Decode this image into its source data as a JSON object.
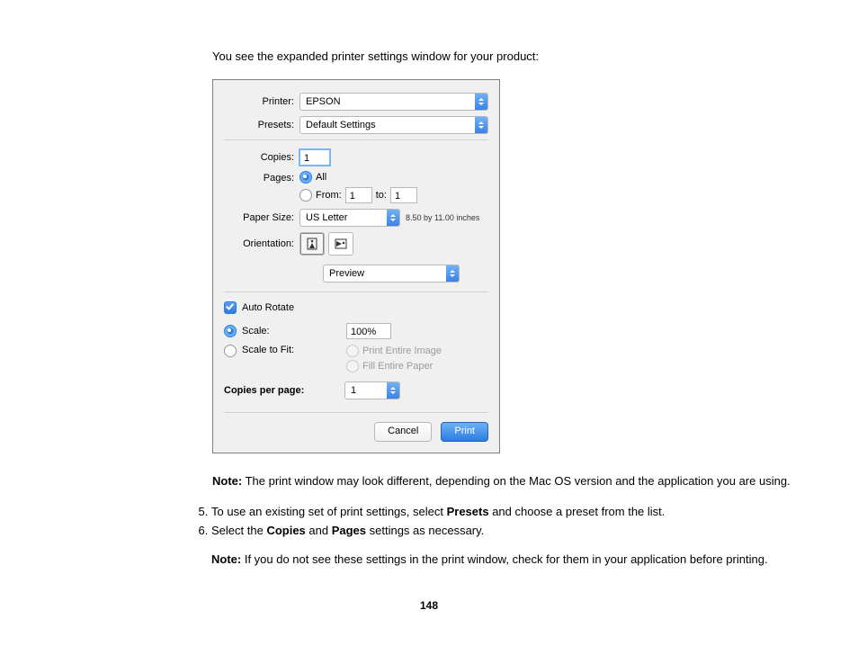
{
  "intro": "You see the expanded printer settings window for your product:",
  "dialog": {
    "labels": {
      "printer": "Printer:",
      "presets": "Presets:",
      "copies": "Copies:",
      "pages": "Pages:",
      "paper_size": "Paper Size:",
      "orientation": "Orientation:",
      "from": "From:",
      "to": "to:",
      "auto_rotate": "Auto Rotate",
      "scale": "Scale:",
      "scale_to_fit": "Scale to Fit:",
      "print_entire": "Print Entire Image",
      "fill_entire": "Fill Entire Paper",
      "copies_per_page": "Copies per page:",
      "cancel": "Cancel",
      "print": "Print"
    },
    "values": {
      "printer": "EPSON",
      "presets": "Default Settings",
      "copies": "1",
      "pages_all": "All",
      "from": "1",
      "to": "1",
      "paper_size": "US Letter",
      "paper_dims": "8.50 by 11.00 inches",
      "section": "Preview",
      "scale": "100%",
      "copies_per_page": "1"
    }
  },
  "note1_prefix": "Note:",
  "note1_text": " The print window may look different, depending on the Mac OS version and the application you are using.",
  "step5_a": "To use an existing set of print settings, select ",
  "step5_b": "Presets",
  "step5_c": " and choose a preset from the list.",
  "step6_a": "Select the ",
  "step6_b": "Copies",
  "step6_c": " and ",
  "step6_d": "Pages",
  "step6_e": " settings as necessary.",
  "note2_prefix": "Note:",
  "note2_text": " If you do not see these settings in the print window, check for them in your application before printing.",
  "page_number": "148"
}
